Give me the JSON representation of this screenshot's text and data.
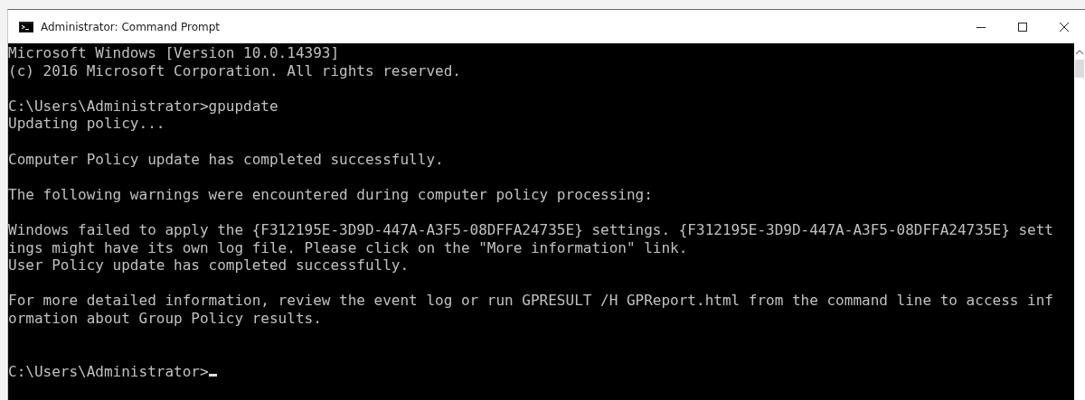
{
  "window": {
    "title": "Administrator: Command Prompt"
  },
  "console": {
    "blocks": [
      [
        "Microsoft Windows [Version 10.0.14393]",
        "(c) 2016 Microsoft Corporation. All rights reserved."
      ],
      [
        "C:\\Users\\Administrator>gpupdate",
        "Updating policy..."
      ],
      [
        "Computer Policy update has completed successfully."
      ],
      [
        "The following warnings were encountered during computer policy processing:"
      ],
      [
        "Windows failed to apply the {F312195E-3D9D-447A-A3F5-08DFFA24735E} settings. {F312195E-3D9D-447A-A3F5-08DFFA24735E} sett",
        "ings might have its own log file. Please click on the \"More information\" link.",
        "User Policy update has completed successfully."
      ],
      [
        "For more detailed information, review the event log or run GPRESULT /H GPReport.html from the command line to access inf",
        "ormation about Group Policy results."
      ]
    ],
    "prompt": "C:\\Users\\Administrator>"
  }
}
